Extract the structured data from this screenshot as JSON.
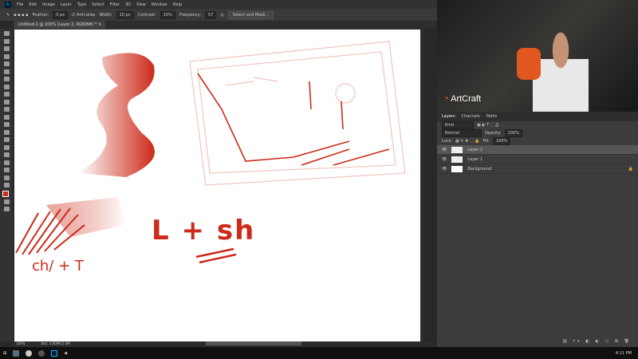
{
  "menu": [
    "File",
    "Edit",
    "Image",
    "Layer",
    "Type",
    "Select",
    "Filter",
    "3D",
    "View",
    "Window",
    "Help"
  ],
  "options": {
    "feather_label": "Feather:",
    "feather": "0 px",
    "antialias": "Anti-alias",
    "width_label": "Width:",
    "width": "10 px",
    "contrast_label": "Contrast:",
    "contrast": "10%",
    "frequency_label": "Frequency:",
    "frequency": "57",
    "select_mask": "Select and Mask..."
  },
  "document_tab": "Untitled-1 @ 100% (Layer 2, RGB/8#) *",
  "status": {
    "zoom": "100%",
    "doc": "Doc: 3.00M/11.0M"
  },
  "webcam": {
    "brand": "ArtCraft"
  },
  "panel": {
    "tabs": [
      "Layers",
      "Channels",
      "Paths"
    ],
    "kind": "Kind",
    "blend": "Normal",
    "opacity_label": "Opacity:",
    "opacity": "100%",
    "lock_label": "Lock:",
    "fill_label": "Fill:",
    "fill": "100%",
    "layers": [
      {
        "name": "Layer 2",
        "selected": true
      },
      {
        "name": "Layer 1",
        "selected": false
      },
      {
        "name": "Background",
        "selected": false
      }
    ]
  },
  "canvas_text": {
    "a": "L + sh",
    "b": "ch/ + T"
  },
  "taskbar": {
    "time": "4:11 PM"
  },
  "colors": {
    "stroke": "#cc2a1a",
    "accent": "#31a8ff"
  }
}
